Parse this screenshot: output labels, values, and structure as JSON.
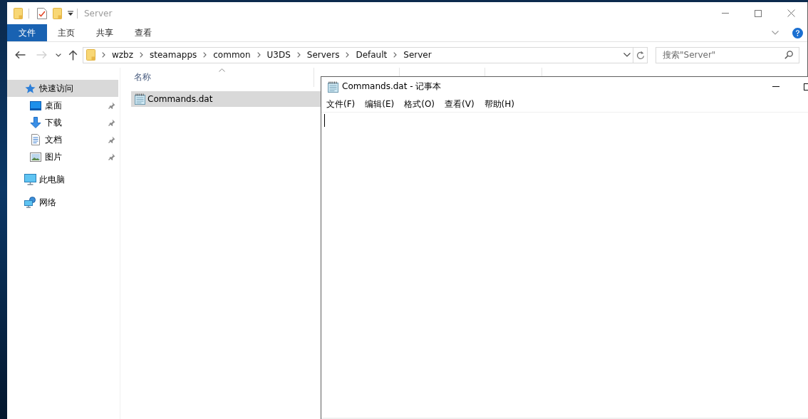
{
  "explorer": {
    "title": "Server",
    "ribbon_tabs": [
      {
        "label": "文件",
        "kind": "file",
        "selected": false
      },
      {
        "label": "主页",
        "kind": "tab",
        "selected": false
      },
      {
        "label": "共享",
        "kind": "tab",
        "selected": false
      },
      {
        "label": "查看",
        "kind": "tab",
        "selected": false
      }
    ],
    "nav_buttons": [
      {
        "kind": "back",
        "disabled": false
      },
      {
        "kind": "forward",
        "disabled": true
      },
      {
        "kind": "recent",
        "disabled": false
      },
      {
        "kind": "up",
        "disabled": false
      }
    ],
    "address": {
      "crumbs": [
        "wzbz",
        "steamapps",
        "common",
        "U3DS",
        "Servers",
        "Default",
        "Server"
      ]
    },
    "search": {
      "placeholder": "搜索\"Server\""
    },
    "sidebar": {
      "items": [
        {
          "label": "快速访问",
          "kind": "star",
          "selected": true,
          "children": [
            {
              "label": "桌面",
              "kind": "desktop",
              "selected": false,
              "pinned": true
            },
            {
              "label": "下载",
              "kind": "download",
              "selected": false,
              "pinned": true
            },
            {
              "label": "文档",
              "kind": "document",
              "selected": false,
              "pinned": true
            },
            {
              "label": "图片",
              "kind": "picture",
              "selected": false,
              "pinned": true
            }
          ]
        },
        {
          "label": "此电脑",
          "kind": "computer",
          "selected": false
        },
        {
          "label": "网络",
          "kind": "network",
          "selected": false
        }
      ]
    },
    "file_list": {
      "columns": [
        {
          "label": "名称",
          "sorted": true
        }
      ],
      "rows": [
        {
          "name": "Commands.dat",
          "selected": true
        }
      ]
    }
  },
  "notepad": {
    "title": "Commands.dat - 记事本",
    "menu": [
      "文件(F)",
      "编辑(E)",
      "格式(O)",
      "查看(V)",
      "帮助(H)"
    ]
  }
}
